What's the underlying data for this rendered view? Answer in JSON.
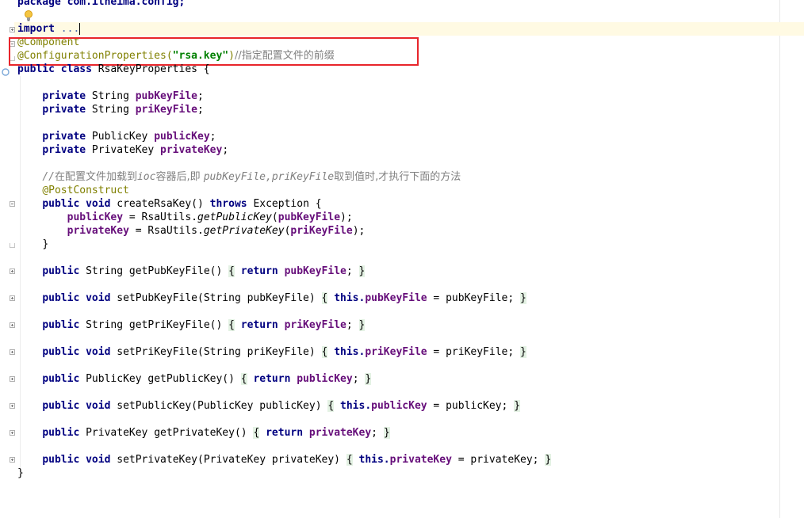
{
  "editor": {
    "line_package": "package com.itheima.config;",
    "import_kw": "import",
    "import_fold": "...",
    "ann_component": "@Component",
    "ann_config_props": "@ConfigurationProperties(",
    "ann_config_str": "\"rsa.key\"",
    "ann_config_close": ")",
    "ann_config_comment": "//指定配置文件的前缀",
    "class_kw": "public class",
    "class_name": " RsaKeyProperties {",
    "private_kw": "private",
    "string_type": " String ",
    "field_pub": "pubKeyFile",
    "field_pri": "priKeyFile",
    "publickey_type": " PublicKey ",
    "privatekey_type": " PrivateKey ",
    "field_publicKey": "publicKey",
    "field_privateKey": "privateKey",
    "semicolon": ";",
    "comment_slashes": "//",
    "comment_part1": "在配置文件加载到",
    "comment_ioc": "ioc",
    "comment_part2": "容器后,即 ",
    "comment_fields": "pubKeyFile,priKeyFile",
    "comment_part3": "取到值时,才执行下面的方法",
    "ann_postconstruct": "@PostConstruct",
    "public_kw": "public",
    "void_kw": "void",
    "throws_kw": "throws",
    "return_kw": "return",
    "this_kw": "this.",
    "create_sig": " createRsaKey() ",
    "create_tail": " Exception {",
    "assign_eq": " = RsaUtils.",
    "get_public_m": "getPublicKey",
    "get_private_m": "getPrivateKey",
    "open_paren": "(",
    "close_paren_semi": ");",
    "close_brace": "}",
    "getPub_sig": " String getPubKeyFile() ",
    "setPub_sig": " setPubKeyFile(String pubKeyFile) ",
    "getPri_sig": " String getPriKeyFile() ",
    "setPri_sig": " setPriKeyFile(String priKeyFile) ",
    "getPublic_sig": " PublicKey getPublicKey() ",
    "setPublic_sig": " setPublicKey(PublicKey publicKey) ",
    "getPrivate_sig": " PrivateKey getPrivateKey() ",
    "setPrivate_sig": " setPrivateKey(PrivateKey privateKey) ",
    "open_brace": "{",
    "param_pub": " = pubKeyFile; ",
    "param_pri": " = priKeyFile; ",
    "param_public": " = publicKey; ",
    "param_private": " = privateKey; "
  },
  "colors": {
    "keyword": "#000080",
    "field": "#660e7a",
    "annotation": "#808000",
    "string": "#008000",
    "comment": "#808080",
    "highlight_box": "#e8252b"
  },
  "icons": {
    "intention": "lightbulb-icon",
    "bookmark": "implemented-marker-icon"
  }
}
